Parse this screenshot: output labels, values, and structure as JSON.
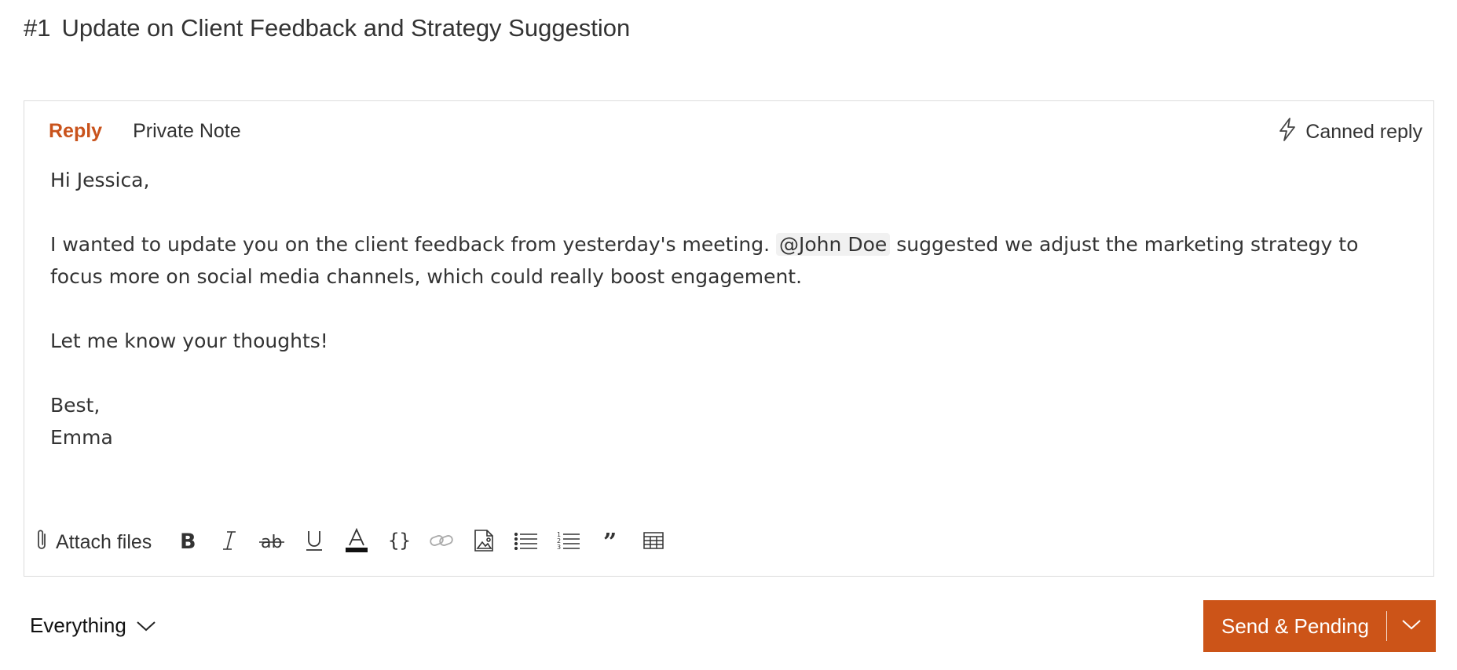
{
  "ticket": {
    "number": "#1",
    "subject": "Update on Client Feedback and Strategy Suggestion"
  },
  "editor": {
    "tabs": [
      {
        "label": "Reply",
        "active": true
      },
      {
        "label": "Private Note",
        "active": false
      }
    ],
    "canned_reply_label": "Canned reply",
    "body": {
      "greeting": "Hi Jessica,",
      "para1_before": "I wanted to update you on the client feedback from yesterday's meeting.",
      "mention": "@John Doe",
      "para1_after": "suggested we adjust the marketing strategy to focus more on social media channels, which could really boost engagement.",
      "para2": "Let me know your thoughts!",
      "signoff": "Best,",
      "signature": "Emma"
    },
    "toolbar": {
      "attach_label": "Attach files",
      "icons": [
        "bold-icon",
        "italic-icon",
        "strikethrough-icon",
        "underline-icon",
        "text-color-icon",
        "code-icon",
        "link-icon",
        "image-icon",
        "bullet-list-icon",
        "numbered-list-icon",
        "quote-icon",
        "table-icon"
      ]
    }
  },
  "footer": {
    "filter_label": "Everything",
    "send_label": "Send & Pending"
  },
  "colors": {
    "accent": "#cc5418",
    "active_tab": "#c9531c"
  }
}
